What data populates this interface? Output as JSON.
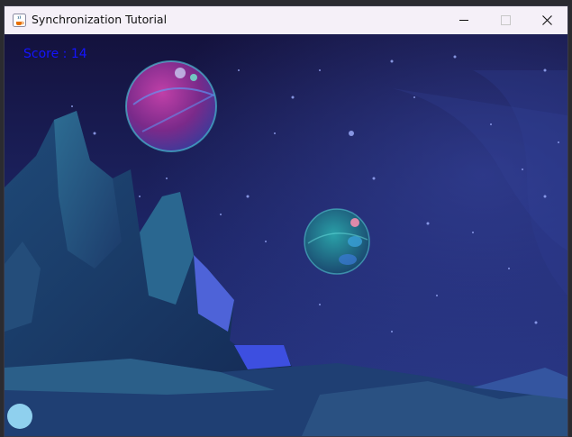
{
  "window": {
    "title": "Synchronization Tutorial",
    "controls": {
      "minimize": "—",
      "maximize": "☐",
      "close": "✕"
    }
  },
  "game": {
    "score_text": "Score : 14",
    "score_color": "#1414ff",
    "player_ball_color": "#8fd0ee",
    "background_theme": "night-space-mountains",
    "planets": [
      {
        "name": "magenta-planet",
        "color": "#a0308c"
      },
      {
        "name": "teal-planet",
        "color": "#1b7a8a"
      }
    ]
  },
  "icons": {
    "app": "java-coffee-cup-icon"
  }
}
